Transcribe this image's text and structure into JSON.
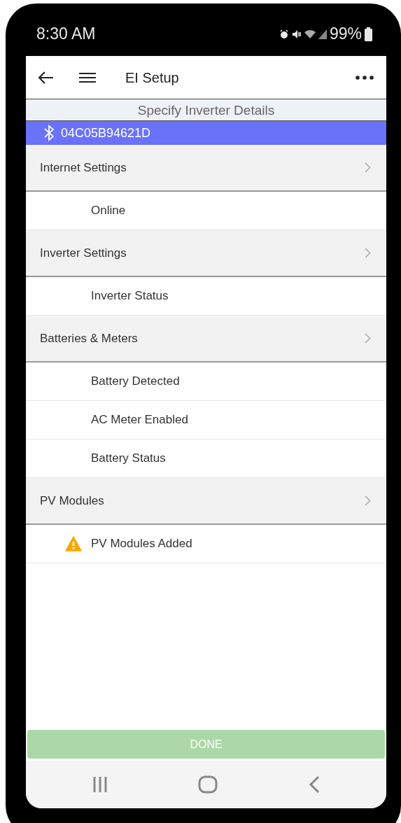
{
  "status_bar": {
    "time": "8:30 AM",
    "battery": "99%"
  },
  "app_bar": {
    "title": "EI Setup"
  },
  "subtitle": "Specify Inverter Details",
  "device": {
    "id": "04C05B94621D"
  },
  "rows": [
    {
      "kind": "header",
      "label": "Internet Settings"
    },
    {
      "kind": "item",
      "label": "Online",
      "warning": false
    },
    {
      "kind": "header",
      "label": "Inverter Settings"
    },
    {
      "kind": "item",
      "label": "Inverter Status",
      "warning": false
    },
    {
      "kind": "header",
      "label": "Batteries & Meters"
    },
    {
      "kind": "item",
      "label": "Battery Detected",
      "warning": false
    },
    {
      "kind": "item",
      "label": "AC Meter Enabled",
      "warning": false
    },
    {
      "kind": "item",
      "label": "Battery Status",
      "warning": false
    },
    {
      "kind": "header",
      "label": "PV Modules"
    },
    {
      "kind": "item",
      "label": "PV Modules Added",
      "warning": true
    }
  ],
  "done_button": {
    "label": "DONE",
    "disabled": true
  }
}
